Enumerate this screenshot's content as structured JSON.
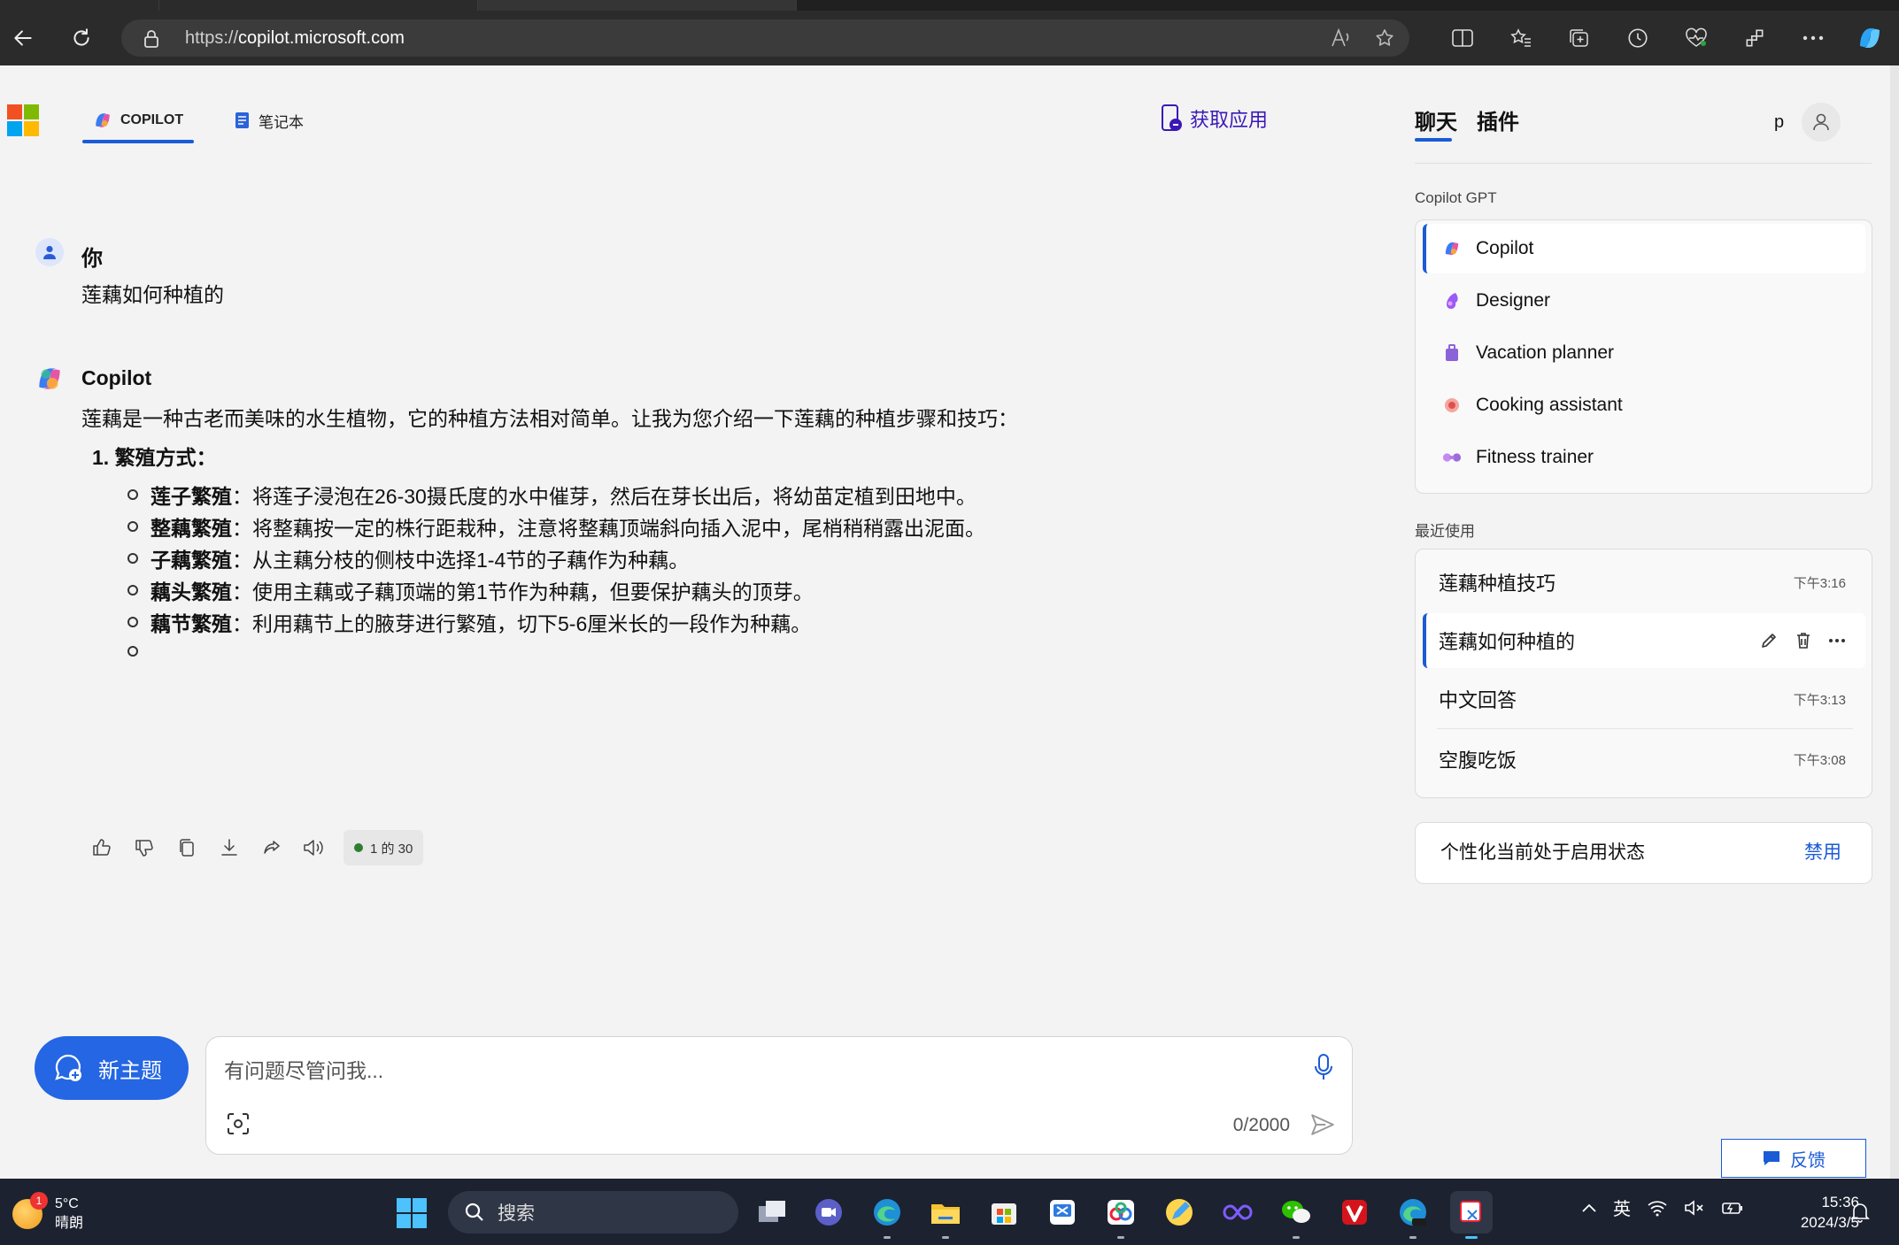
{
  "browser": {
    "url_prefix": "https://",
    "url_host": "copilot.microsoft.com"
  },
  "nav": {
    "copilot_tab": "COPILOT",
    "notebook_tab": "笔记本",
    "get_app": "获取应用"
  },
  "chat": {
    "user_label": "你",
    "user_message": "莲藕如何种植的",
    "bot_label": "Copilot",
    "intro": "莲藕是一种古老而美味的水生植物，它的种植方法相对简单。让我为您介绍一下莲藕的种植步骤和技巧：",
    "section_heading": "1. 繁殖方式：",
    "items": [
      {
        "title": "莲子繁殖",
        "text": "：将莲子浸泡在26-30摄氏度的水中催芽，然后在芽长出后，将幼苗定植到田地中。"
      },
      {
        "title": "整藕繁殖",
        "text": "：将整藕按一定的株行距栽种，注意将整藕顶端斜向插入泥中，尾梢稍稍露出泥面。"
      },
      {
        "title": "子藕繁殖",
        "text": "：从主藕分枝的侧枝中选择1-4节的子藕作为种藕。"
      },
      {
        "title": "藕头繁殖",
        "text": "：使用主藕或子藕顶端的第1节作为种藕，但要保护藕头的顶芽。"
      },
      {
        "title": "藕节繁殖",
        "text": "：利用藕节上的腋芽进行繁殖，切下5-6厘米长的一段作为种藕。"
      }
    ],
    "turn_badge": "1 的 30"
  },
  "composer": {
    "new_topic": "新主题",
    "placeholder": "有问题尽管问我...",
    "char_count": "0/2000"
  },
  "right_panel": {
    "tab_chat": "聊天",
    "tab_plugins": "插件",
    "profile_initial": "p",
    "gpt_section": "Copilot GPT",
    "gpts": [
      {
        "name": "Copilot",
        "icon": "copilot-icon"
      },
      {
        "name": "Designer",
        "icon": "designer-icon"
      },
      {
        "name": "Vacation planner",
        "icon": "suitcase-icon"
      },
      {
        "name": "Cooking assistant",
        "icon": "cooking-icon"
      },
      {
        "name": "Fitness trainer",
        "icon": "dumbbell-icon"
      }
    ],
    "recent_section": "最近使用",
    "recent": [
      {
        "title": "莲藕种植技巧",
        "time": "下午3:16"
      },
      {
        "title": "莲藕如何种植的",
        "time": ""
      },
      {
        "title": "中文回答",
        "time": "下午3:13"
      },
      {
        "title": "空腹吃饭",
        "time": "下午3:08"
      }
    ],
    "personalization_text": "个性化当前处于启用状态",
    "personalization_action": "禁用",
    "feedback": "反馈"
  },
  "taskbar": {
    "weather_temp": "5°C",
    "weather_desc": "晴朗",
    "weather_badge": "1",
    "search_label": "搜索",
    "ime": "英",
    "time": "15:36",
    "date": "2024/3/5"
  },
  "colors": {
    "accent": "#1a5bd6",
    "new_topic_bg": "#2466e3",
    "get_app": "#3b18b6",
    "taskbar": "#1c2230"
  }
}
